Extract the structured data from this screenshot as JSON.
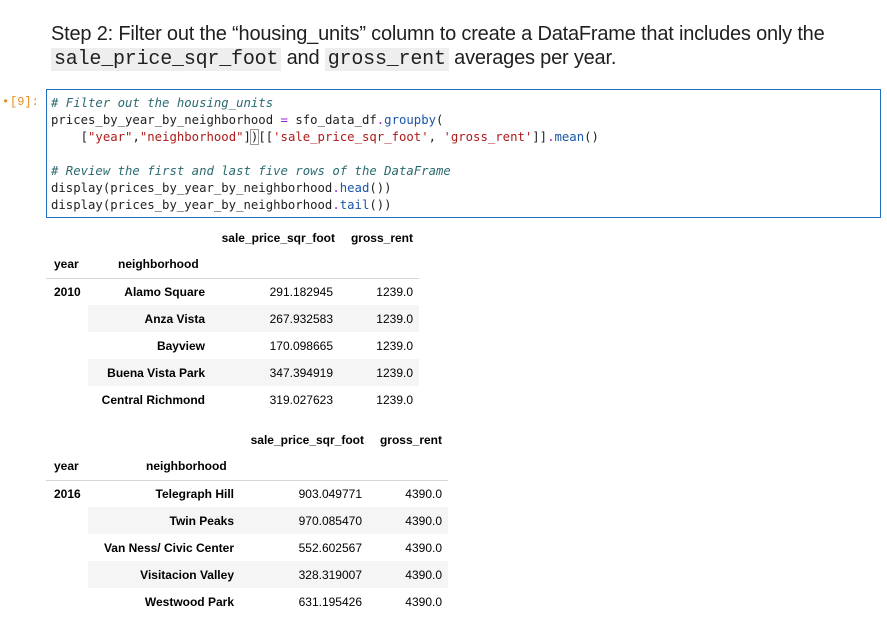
{
  "markdown": {
    "heading_part1": "Step 2: Filter out the “housing_units” column to create a DataFrame that includes only the",
    "code1": "sale_price_sqr_foot",
    "and": "and",
    "code2": "gross_rent",
    "heading_part2": "averages per year."
  },
  "cell": {
    "prompt": "[9]:",
    "marker": "•"
  },
  "table1": {
    "columns": [
      "sale_price_sqr_foot",
      "gross_rent"
    ],
    "index_names": [
      "year",
      "neighborhood"
    ],
    "year": "2010",
    "rows": [
      {
        "neighborhood": "Alamo Square",
        "price": "291.182945",
        "rent": "1239.0"
      },
      {
        "neighborhood": "Anza Vista",
        "price": "267.932583",
        "rent": "1239.0"
      },
      {
        "neighborhood": "Bayview",
        "price": "170.098665",
        "rent": "1239.0"
      },
      {
        "neighborhood": "Buena Vista Park",
        "price": "347.394919",
        "rent": "1239.0"
      },
      {
        "neighborhood": "Central Richmond",
        "price": "319.027623",
        "rent": "1239.0"
      }
    ]
  },
  "table2": {
    "columns": [
      "sale_price_sqr_foot",
      "gross_rent"
    ],
    "index_names": [
      "year",
      "neighborhood"
    ],
    "year": "2016",
    "rows": [
      {
        "neighborhood": "Telegraph Hill",
        "price": "903.049771",
        "rent": "4390.0"
      },
      {
        "neighborhood": "Twin Peaks",
        "price": "970.085470",
        "rent": "4390.0"
      },
      {
        "neighborhood": "Van Ness/ Civic Center",
        "price": "552.602567",
        "rent": "4390.0"
      },
      {
        "neighborhood": "Visitacion Valley",
        "price": "328.319007",
        "rent": "4390.0"
      },
      {
        "neighborhood": "Westwood Park",
        "price": "631.195426",
        "rent": "4390.0"
      }
    ]
  }
}
